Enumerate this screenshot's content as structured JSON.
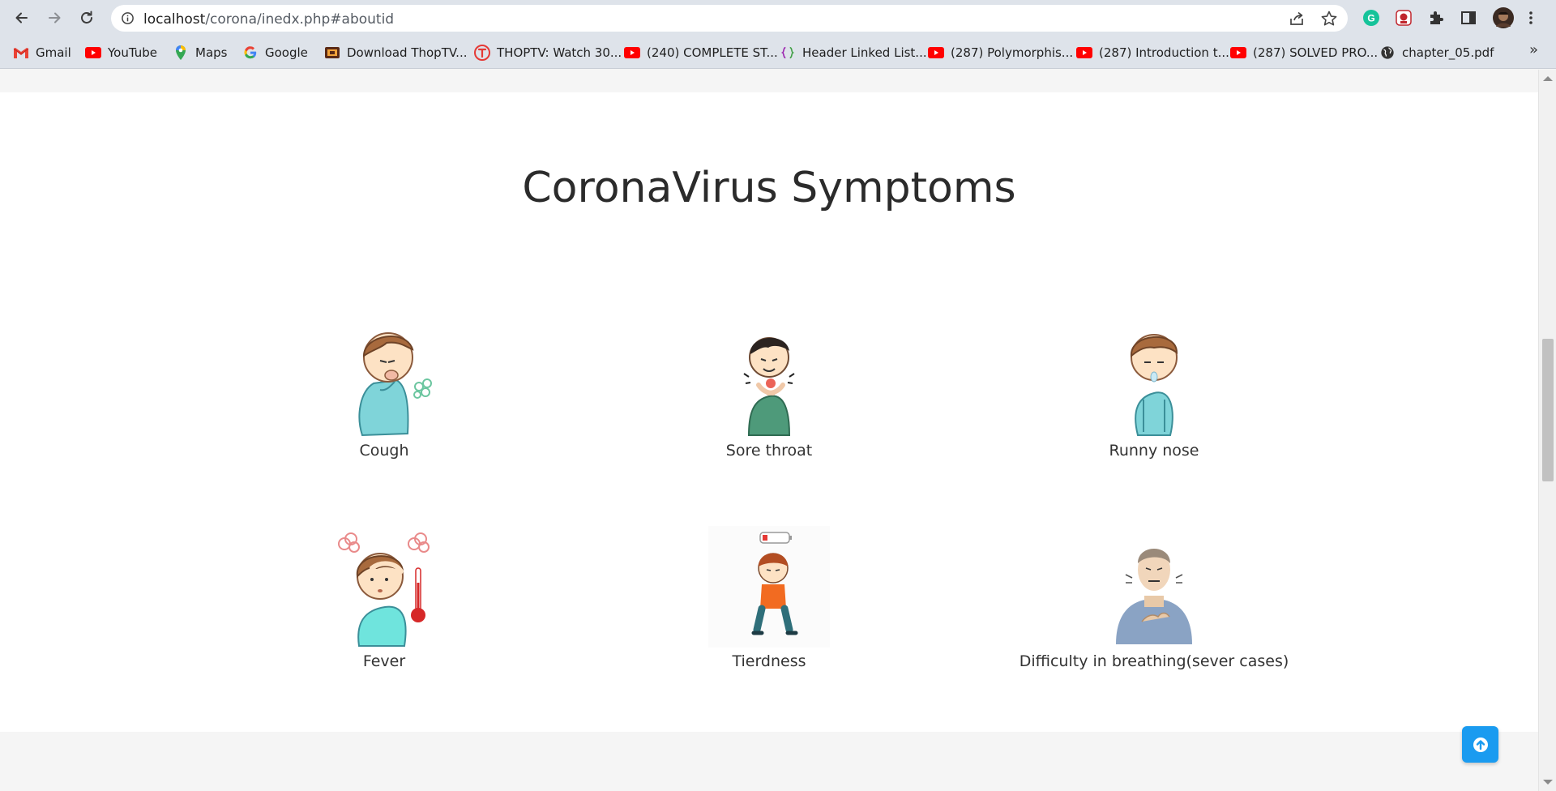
{
  "browser": {
    "url_host": "localhost",
    "url_path": "/corona/inedx.php#aboutid",
    "bookmarks": [
      "Gmail",
      "YouTube",
      "Maps",
      "Google",
      "Download ThopTV...",
      "THOPTV: Watch 30...",
      "(240) COMPLETE ST...",
      "Header Linked List...",
      "(287) Polymorphis...",
      "(287) Introduction t...",
      "(287) SOLVED PRO...",
      "chapter_05.pdf"
    ],
    "more_bookmarks": "»"
  },
  "section": {
    "title": "CoronaVirus Symptoms",
    "symptoms": [
      "Cough",
      "Sore throat",
      "Runny nose",
      "Fever",
      "Tierdness",
      "Difficulty in breathing(sever cases)"
    ]
  },
  "colors": {
    "accent": "#1a9bf0",
    "chrome": "#dee3ea",
    "shirt": "#7fd4d9"
  }
}
